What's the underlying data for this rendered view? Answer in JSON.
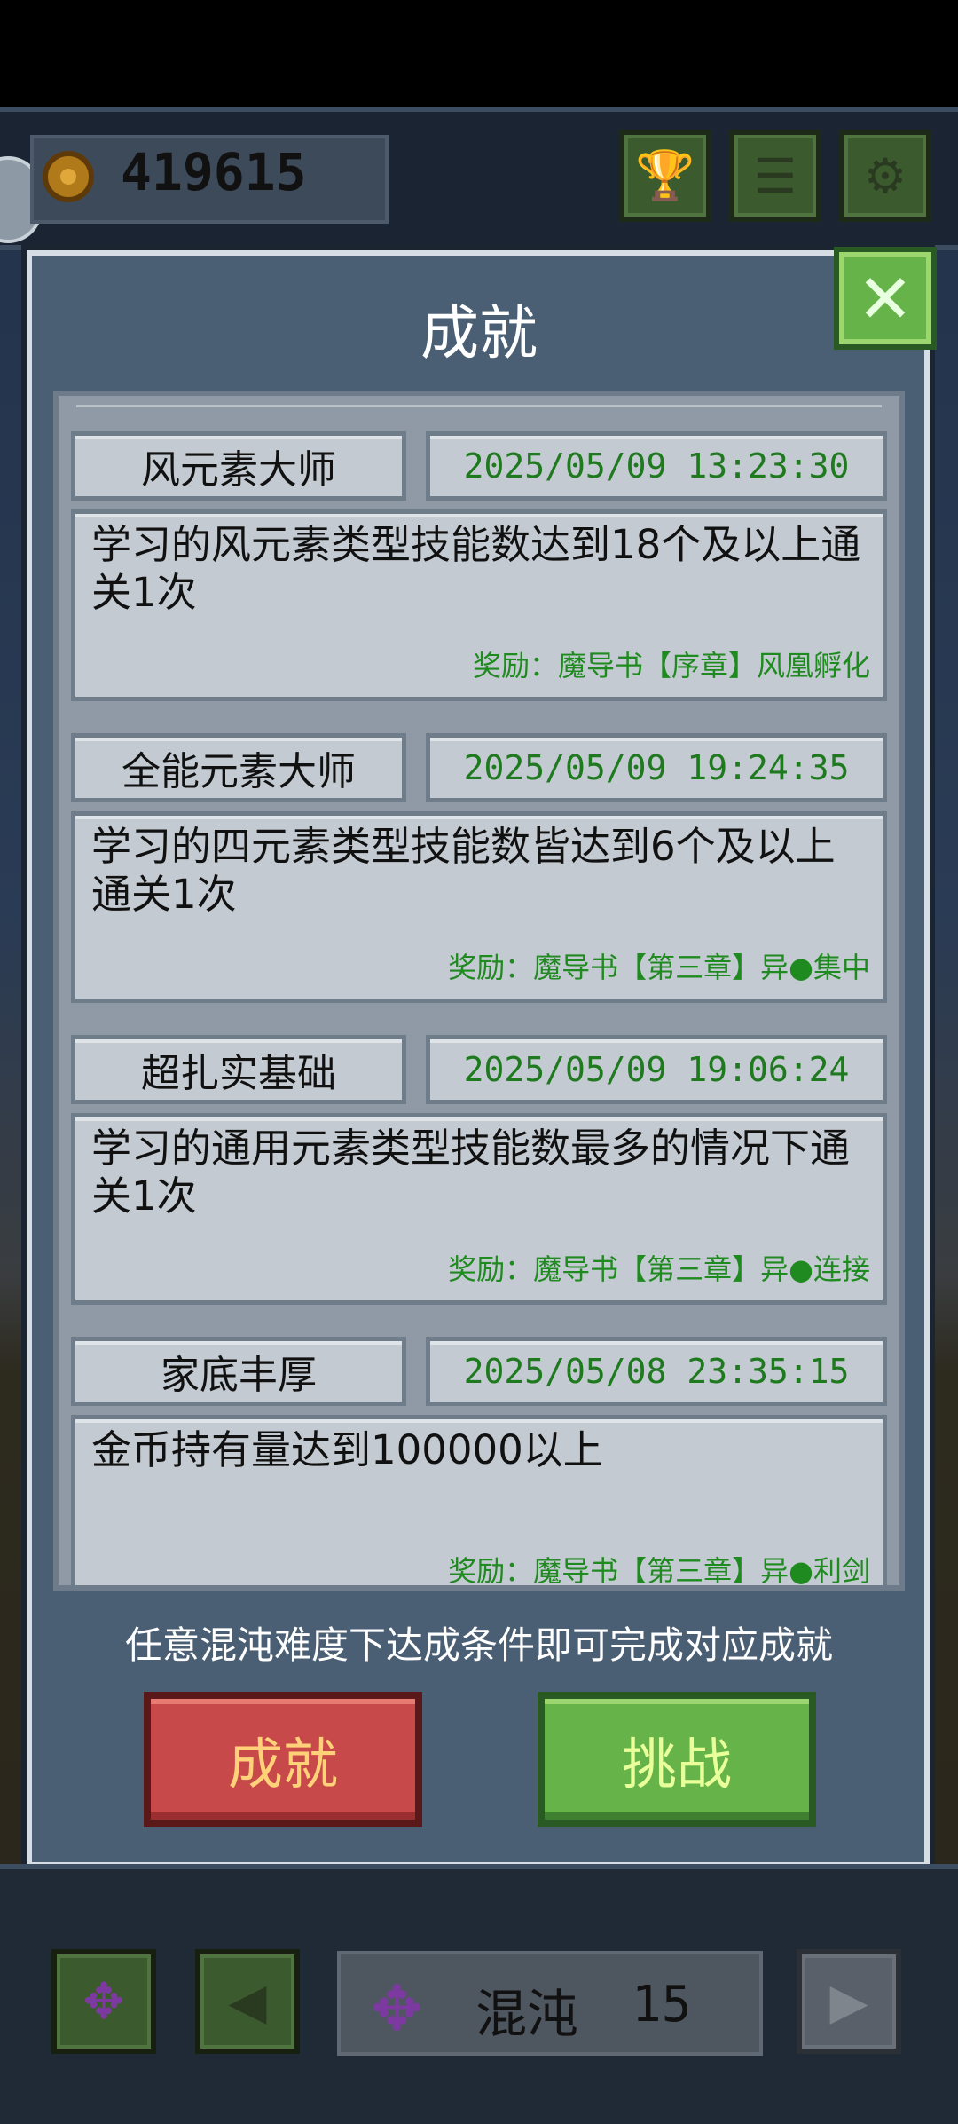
{
  "hud": {
    "coins": "419615",
    "trophy_icon": "trophy-icon",
    "list_icon": "list-icon",
    "settings_icon": "gear-icon"
  },
  "modal": {
    "title": "成就",
    "close_icon": "close-icon",
    "achievements": [
      {
        "name": "风元素大师",
        "date": "2025/05/09 13:23:30",
        "desc": "学习的风元素类型技能数达到18个及以上通关1次",
        "reward": "奖励：魔导书【序章】风凰孵化"
      },
      {
        "name": "全能元素大师",
        "date": "2025/05/09 19:24:35",
        "desc": "学习的四元素类型技能数皆达到6个及以上通关1次",
        "reward": "奖励：魔导书【第三章】异●集中"
      },
      {
        "name": "超扎实基础",
        "date": "2025/05/09 19:06:24",
        "desc": "学习的通用元素类型技能数最多的情况下通关1次",
        "reward": "奖励：魔导书【第三章】异●连接"
      },
      {
        "name": "家底丰厚",
        "date": "2025/05/08 23:35:15",
        "desc": "金币持有量达到100000以上",
        "reward": "奖励：魔导书【第三章】异●利剑"
      }
    ],
    "hint": "任意混沌难度下达成条件即可完成对应成就",
    "achievements_button": "成就",
    "challenge_button": "挑战"
  },
  "footer": {
    "mode_label": "混沌",
    "mode_level": "15",
    "prev_icon": "arrow-left-icon",
    "next_icon": "arrow-right-icon",
    "chaos_icon": "chaos-icon"
  },
  "colors": {
    "accent_green": "#66b34a",
    "accent_red": "#c8494a",
    "date_text": "#1f7a1f",
    "panel": "#4a5e74"
  }
}
